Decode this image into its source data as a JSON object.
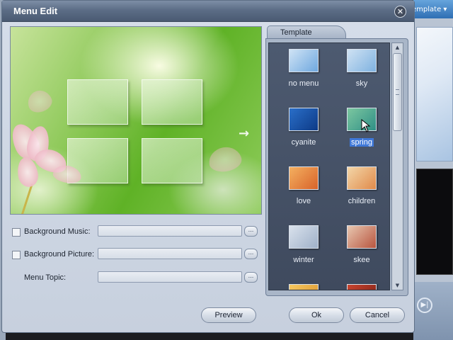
{
  "background_app": {
    "template_button_label": "emplate ▾"
  },
  "dialog": {
    "title": "Menu Edit",
    "close_glyph": "✕"
  },
  "preview": {
    "next_arrow_glyph": "→"
  },
  "fields": {
    "background_music": {
      "label": "Background Music:",
      "checked": false,
      "value": ""
    },
    "background_picture": {
      "label": "Background Picture:",
      "checked": false,
      "value": ""
    },
    "menu_topic": {
      "label": "Menu Topic:",
      "value": ""
    },
    "browse_glyph": "..."
  },
  "template_panel": {
    "tab_label": "Template",
    "selected": "spring",
    "items": [
      {
        "label": "no menu",
        "colors": [
          "#cfe3f5",
          "#6fa8df"
        ]
      },
      {
        "label": "sky",
        "colors": [
          "#cfe2f3",
          "#7fb2e0"
        ]
      },
      {
        "label": "cyanite",
        "colors": [
          "#2a6fc9",
          "#0d3a86"
        ]
      },
      {
        "label": "spring",
        "colors": [
          "#7cc7a0",
          "#2f8f86"
        ]
      },
      {
        "label": "love",
        "colors": [
          "#f4b060",
          "#d8632a"
        ]
      },
      {
        "label": "children",
        "colors": [
          "#f3d6a8",
          "#e08a4a"
        ]
      },
      {
        "label": "winter",
        "colors": [
          "#d9e1ec",
          "#9fb1c9"
        ]
      },
      {
        "label": "skee",
        "colors": [
          "#e8c7b0",
          "#b8553f"
        ]
      }
    ]
  },
  "buttons": {
    "preview": "Preview",
    "ok": "Ok",
    "cancel": "Cancel"
  },
  "colors": {
    "title_bar": "#5c6d86",
    "dialog_bg": "#cfd7e3",
    "list_bg": "#46536a",
    "selection": "#3f78d8"
  }
}
